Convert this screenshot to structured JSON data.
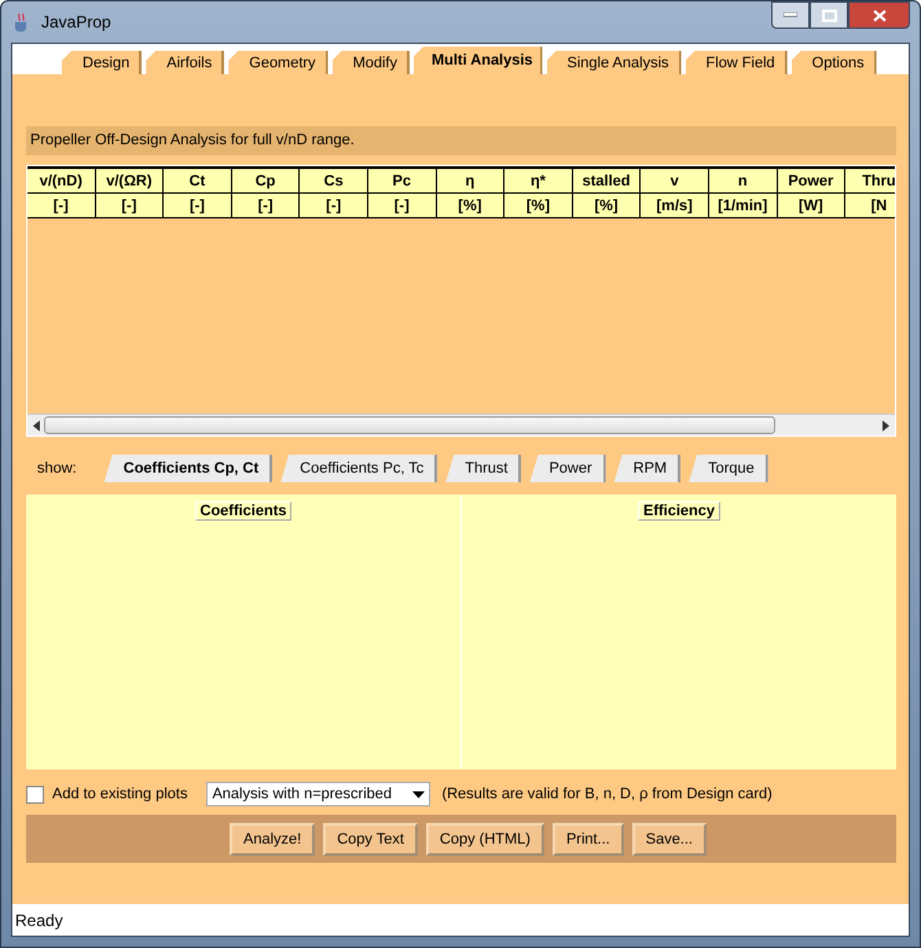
{
  "window": {
    "title": "JavaProp"
  },
  "tabs": [
    {
      "label": "Design",
      "selected": false
    },
    {
      "label": "Airfoils",
      "selected": false
    },
    {
      "label": "Geometry",
      "selected": false
    },
    {
      "label": "Modify",
      "selected": false
    },
    {
      "label": "Multi Analysis",
      "selected": true
    },
    {
      "label": "Single Analysis",
      "selected": false
    },
    {
      "label": "Flow Field",
      "selected": false
    },
    {
      "label": "Options",
      "selected": false
    }
  ],
  "heading": "Propeller Off-Design Analysis for full v/nD range.",
  "table": {
    "columns": [
      {
        "name": "v/(nD)",
        "unit": "[-]"
      },
      {
        "name": "v/(ΩR)",
        "unit": "[-]"
      },
      {
        "name": "Ct",
        "unit": "[-]"
      },
      {
        "name": "Cp",
        "unit": "[-]"
      },
      {
        "name": "Cs",
        "unit": "[-]"
      },
      {
        "name": "Pc",
        "unit": "[-]"
      },
      {
        "name": "η",
        "unit": "[%]"
      },
      {
        "name": "η*",
        "unit": "[%]"
      },
      {
        "name": "stalled",
        "unit": "[%]"
      },
      {
        "name": "v",
        "unit": "[m/s]"
      },
      {
        "name": "n",
        "unit": "[1/min]"
      },
      {
        "name": "Power",
        "unit": "[W]"
      },
      {
        "name": "Thru",
        "unit": "[N"
      }
    ]
  },
  "show": {
    "label": "show:",
    "tabs": [
      {
        "label": "Coefficients Cp, Ct",
        "selected": true
      },
      {
        "label": "Coefficients Pc, Tc",
        "selected": false
      },
      {
        "label": "Thrust",
        "selected": false
      },
      {
        "label": "Power",
        "selected": false
      },
      {
        "label": "RPM",
        "selected": false
      },
      {
        "label": "Torque",
        "selected": false
      }
    ]
  },
  "plots": [
    {
      "title": "Coefficients"
    },
    {
      "title": "Efficiency"
    }
  ],
  "options": {
    "add_to_existing": {
      "label": "Add to existing plots",
      "checked": false
    },
    "mode": {
      "value": "Analysis with n=prescribed"
    },
    "note": "(Results are valid for B, n, D, ρ  from Design card)"
  },
  "buttons": [
    "Analyze!",
    "Copy Text",
    "Copy (HTML)",
    "Print...",
    "Save..."
  ],
  "status_bar": "Ready"
}
